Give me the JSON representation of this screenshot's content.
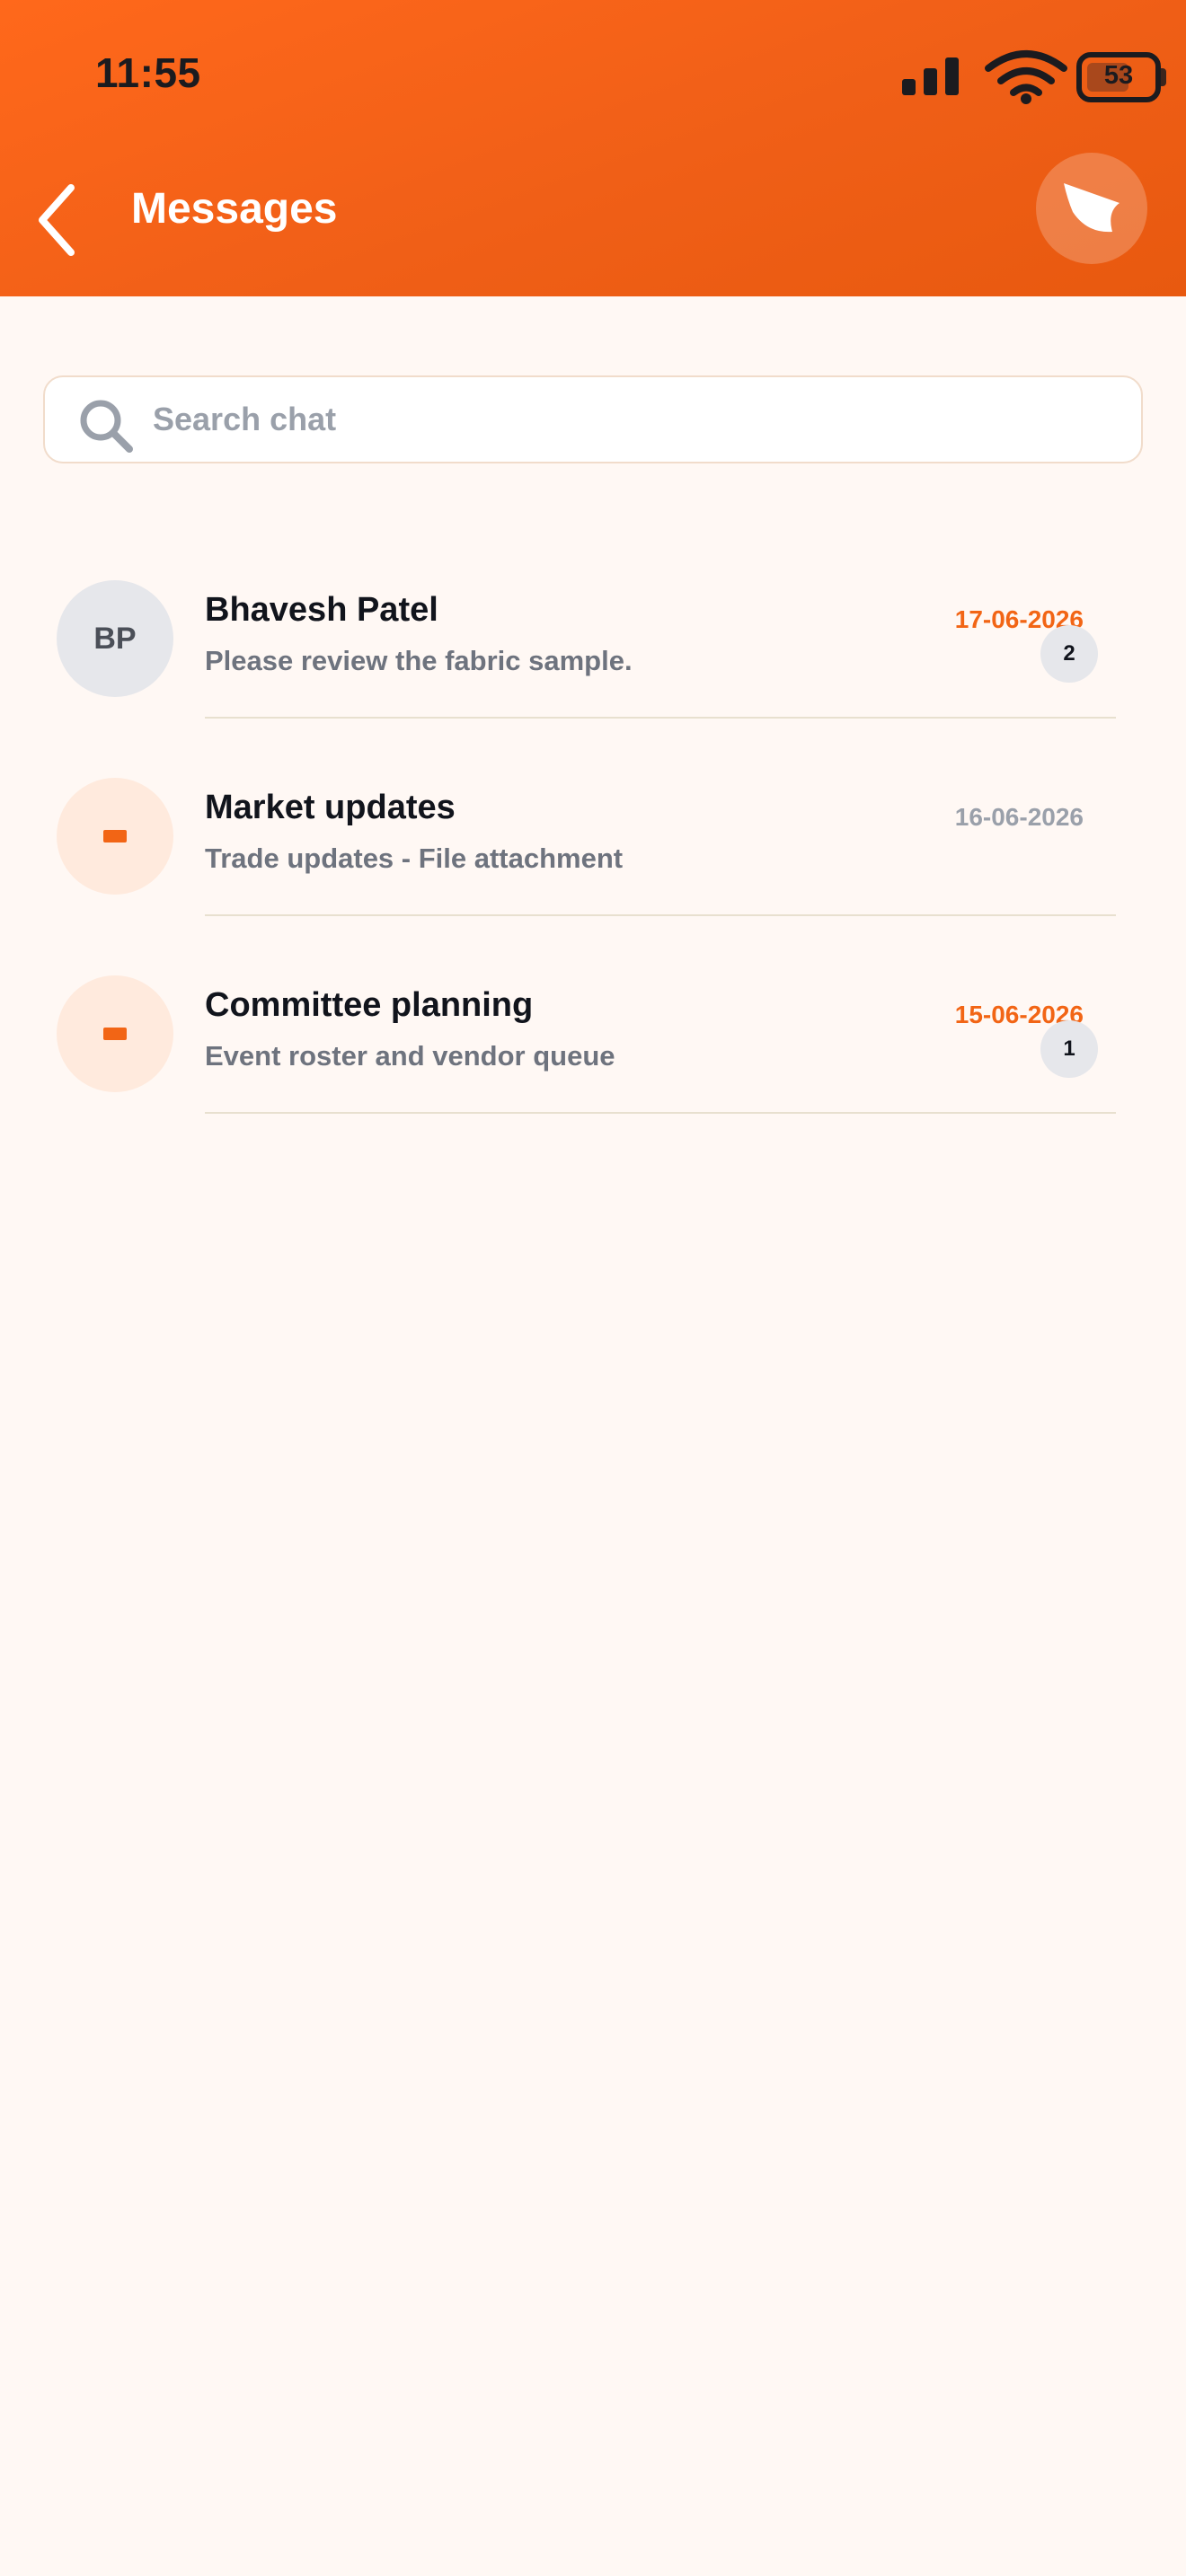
{
  "status_bar": {
    "time": "11:55",
    "battery": "53"
  },
  "header": {
    "title": "Messages"
  },
  "search": {
    "placeholder": "Search chat"
  },
  "colors": {
    "accent": "#F26515",
    "date_highlight": "#F26515",
    "date_muted": "#9AA0AA"
  },
  "chats": [
    {
      "avatar_type": "initials",
      "initials": "BP",
      "name": "Bhavesh Patel",
      "preview": "Please review the fabric sample.",
      "date": "17-06-2026",
      "unread": "2",
      "highlight": true
    },
    {
      "avatar_type": "group-icon",
      "initials": "",
      "name": "Market updates",
      "preview": "Trade updates - File attachment",
      "date": "16-06-2026",
      "unread": "",
      "highlight": false
    },
    {
      "avatar_type": "group-icon",
      "initials": "",
      "name": "Committee planning",
      "preview": "Event roster and vendor queue",
      "date": "15-06-2026",
      "unread": "1",
      "highlight": true
    }
  ]
}
